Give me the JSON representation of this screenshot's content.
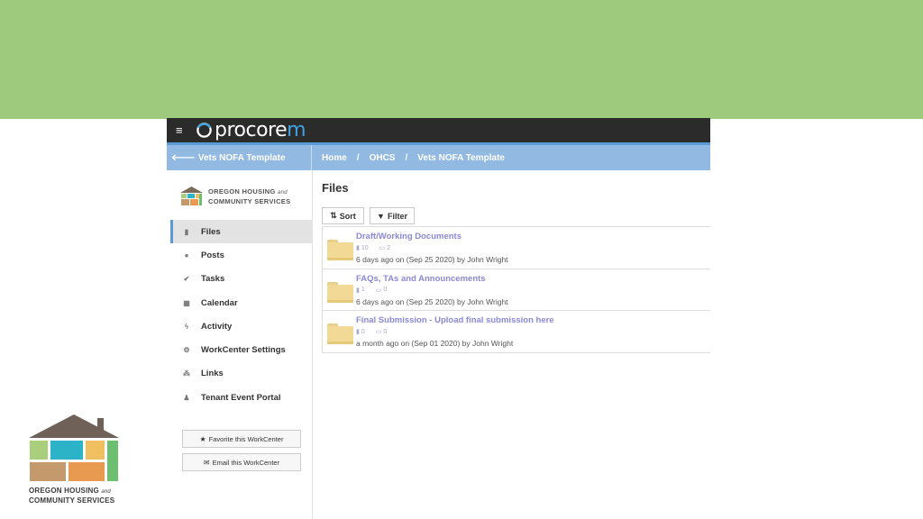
{
  "app": {
    "brand": "procore",
    "brand_m": "m",
    "menu_icon": "hamburger-icon"
  },
  "navbar": {
    "back_label": "Vets NOFA Template",
    "breadcrumbs": [
      "Home",
      "OHCS",
      "Vets NOFA Template"
    ],
    "separator": "/"
  },
  "org": {
    "line1": "OREGON HOUSING",
    "and": "and",
    "line2": "COMMUNITY SERVICES"
  },
  "sidebar": {
    "items": [
      {
        "label": "Files",
        "icon": "file-icon",
        "active": true
      },
      {
        "label": "Posts",
        "icon": "comments-icon"
      },
      {
        "label": "Tasks",
        "icon": "check-icon"
      },
      {
        "label": "Calendar",
        "icon": "calendar-icon"
      },
      {
        "label": "Activity",
        "icon": "bolt-icon"
      },
      {
        "label": "WorkCenter Settings",
        "icon": "gear-icon"
      },
      {
        "label": "Links",
        "icon": "sitemap-icon"
      },
      {
        "label": "Tenant Event Portal",
        "icon": "users-icon"
      }
    ],
    "favorite_label": "Favorite this WorkCenter",
    "email_label": "Email this WorkCenter"
  },
  "main": {
    "title": "Files",
    "sort_label": "Sort",
    "filter_label": "Filter",
    "folders": [
      {
        "name": "Draft/Working Documents",
        "files": "10",
        "subfolders": "2",
        "date": "6 days ago on (Sep 25 2020) by John Wright"
      },
      {
        "name": "FAQs, TAs and Announcements",
        "files": "1",
        "subfolders": "0",
        "date": "6 days ago on (Sep 25 2020) by John Wright"
      },
      {
        "name": "Final Submission - Upload final submission here",
        "files": "0",
        "subfolders": "0",
        "date": "a month ago on (Sep 01 2020) by John Wright"
      }
    ]
  },
  "footer_logo": {
    "line1": "OREGON HOUSING",
    "and": "and",
    "line2": "COMMUNITY SERVICES"
  },
  "colors": {
    "banner": "#9dca7d",
    "navbar": "#92b9e2",
    "link": "#8b88d6",
    "topbar": "#2b2b2b"
  }
}
